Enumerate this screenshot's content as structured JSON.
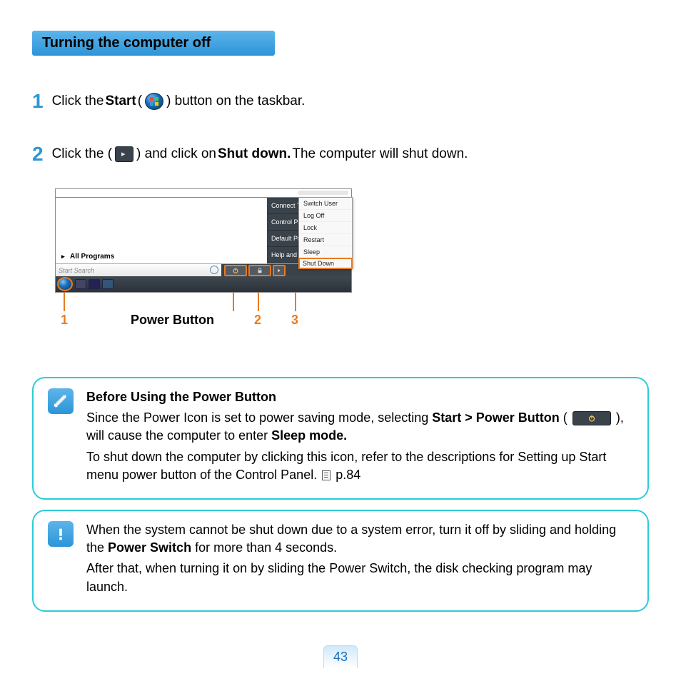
{
  "section_title": "Turning the computer off",
  "steps": [
    {
      "num": "1",
      "pre": "Click the ",
      "bold": "Start",
      "mid": " (",
      "post": ") button on the taskbar."
    },
    {
      "num": "2",
      "pre": "Click the (",
      "mid": ") and click on ",
      "bold": "Shut down.",
      "post": " The computer will shut down."
    }
  ],
  "screenshot": {
    "right_panel": [
      "Connect To",
      "Control Panel",
      "Default Programs",
      "Help and Support"
    ],
    "all_programs": "All Programs",
    "search_placeholder": "Start Search",
    "menu": [
      "Switch User",
      "Log Off",
      "Lock",
      "Restart",
      "Sleep",
      "Shut Down"
    ]
  },
  "callouts": {
    "c1": "1",
    "power_button": "Power Button",
    "c2": "2",
    "c3": "3"
  },
  "note1": {
    "title": "Before Using the Power Button",
    "line1a": "Since the Power Icon is set to power saving mode, selecting ",
    "line1b": "Start > Power Button",
    "line1c": " (",
    "line1d": "), will cause the computer to enter ",
    "line1e": "Sleep mode.",
    "line2": "To shut down the computer by clicking this icon, refer to the descriptions for Setting up Start menu power button of the Control Panel. ",
    "pageref": " p.84"
  },
  "note2": {
    "line1a": "When the system cannot be shut down due to a system error, turn it off by sliding and holding the ",
    "line1b": "Power Switch",
    "line1c": " for more than 4 seconds.",
    "line2": "After that, when turning it on by sliding the Power Switch, the disk checking program may launch."
  },
  "page_number": "43"
}
